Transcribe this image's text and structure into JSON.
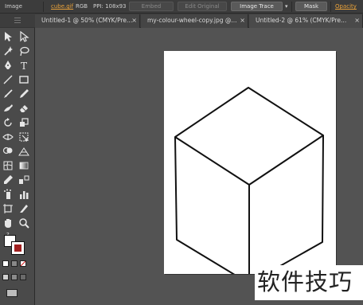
{
  "control_bar": {
    "mode_label": "Image",
    "file_link": "cube.gif",
    "color_mode": "RGB",
    "ppi": "PPI: 108x93",
    "embed_button": "Embed",
    "edit_original_button": "Edit Original",
    "image_trace_button": "Image Trace",
    "dropdown_arrow": "▾",
    "mask_button": "Mask",
    "opacity_label": "Opacity"
  },
  "tabs": [
    {
      "label": "Untitled-1 @ 50% (CMYK/Pre...",
      "close": "×"
    },
    {
      "label": "my-colour-wheel-copy.jpg @...",
      "close": "×"
    },
    {
      "label": "Untitled-2 @ 61% (CMYK/Pre...",
      "close": "×"
    }
  ],
  "tools": {
    "text_tool": "T",
    "default_colors": "?",
    "tool_names": [
      "selection-tool-icon",
      "direct-selection-tool-icon",
      "magic-wand-icon",
      "lasso-icon",
      "pen-tool-icon",
      "type-tool-icon",
      "line-tool-icon",
      "rectangle-tool-icon",
      "paintbrush-icon",
      "pencil-icon",
      "blob-brush-icon",
      "eraser-icon",
      "rotate-tool-icon",
      "scale-tool-icon",
      "width-tool-icon",
      "free-transform-icon",
      "shape-builder-icon",
      "perspective-grid-icon",
      "mesh-tool-icon",
      "gradient-tool-icon",
      "eyedropper-icon",
      "blend-tool-icon",
      "symbol-sprayer-icon",
      "column-graph-icon",
      "artboard-tool-icon",
      "slice-tool-icon",
      "hand-tool-icon",
      "zoom-tool-icon"
    ]
  },
  "watermark": {
    "text": "软件技巧"
  },
  "colors": {
    "accent_orange": "#e8a13a",
    "stroke_color": "#a02020",
    "canvas_bg": "#535353",
    "artboard": "#ffffff"
  }
}
